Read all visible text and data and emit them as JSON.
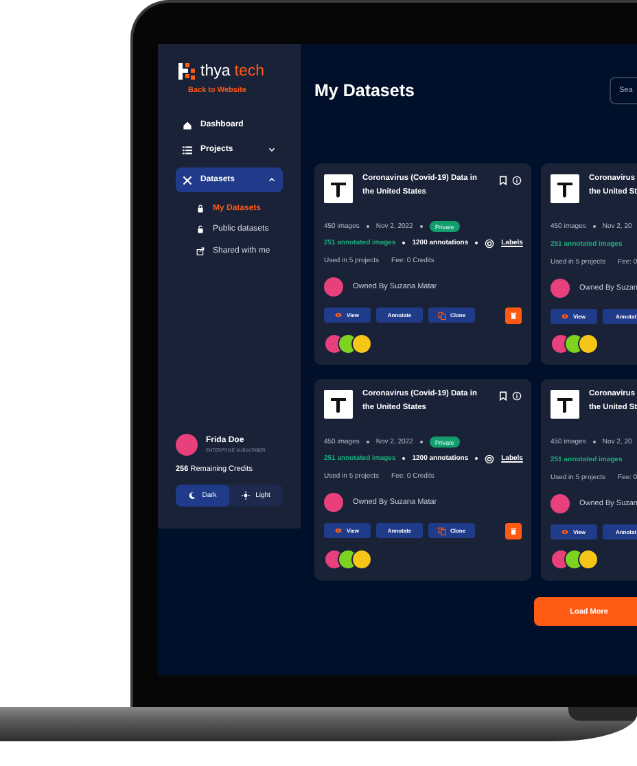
{
  "sidebar": {
    "logo": {
      "part_1": "thya",
      "part_2": "tech"
    },
    "back_link": "Back to Website",
    "nav": [
      {
        "kind": "link",
        "label": "Dashboard",
        "selected": false
      },
      {
        "kind": "group",
        "label": "Projects",
        "selected": false,
        "expanded": false
      },
      {
        "kind": "group",
        "label": "Datasets",
        "selected": true,
        "expanded": true,
        "children": [
          {
            "label": "My Datasets",
            "selected": true
          },
          {
            "label": "Public datasets",
            "selected": false
          },
          {
            "label": "Shared with me",
            "selected": false
          }
        ]
      }
    ],
    "user": {
      "name": "Frida Doe",
      "role": "ENTERPRISE SUBSCRIBER",
      "credits": "**256** Remaining Credits"
    },
    "theme": [
      {
        "label": "Dark",
        "selected": true
      },
      {
        "label": "Light",
        "selected": false
      }
    ]
  },
  "main": {
    "title": "My Datasets",
    "search": {
      "placeholder": "Sea"
    },
    "cards": [
      {
        "title_lines": [
          "Coronavirus (Covid-19) Data in",
          "the United States"
        ],
        "images": "450 images",
        "date": "Nov 2, 2022",
        "privacy": "Private",
        "annotated": "251 annotated images",
        "annotations": "1200 annotations",
        "labels": "Labels",
        "used": "Used in 5 projects",
        "fee": "Fee: 0 Credits",
        "owner": "Owned By Suzana Matar",
        "buttons": [
          {
            "kind": "view",
            "label": "View"
          },
          {
            "kind": "annotate",
            "label": "Annotate"
          },
          {
            "kind": "clone",
            "label": "Clone"
          },
          {
            "kind": "delete"
          }
        ]
      },
      {
        "title_lines": [
          "Coronavirus",
          "the United St"
        ],
        "images": "450 images",
        "date": "Nov 2, 20",
        "annotated": "251 annotated images",
        "used": "Used in 5 projects",
        "fee": "Fee: 0",
        "owner": "Owned By Suzan",
        "buttons": [
          {
            "kind": "view",
            "label": "View"
          },
          {
            "kind": "annotate",
            "label": "Annotat"
          }
        ]
      },
      {
        "title_lines": [
          "Coronavirus (Covid-19) Data in",
          "the United States"
        ],
        "images": "450 images",
        "date": "Nov 2, 2022",
        "privacy": "Private",
        "annotated": "251 annotated images",
        "annotations": "1200 annotations",
        "labels": "Labels",
        "used": "Used in 5 projects",
        "fee": "Fee: 0 Credits",
        "owner": "Owned By Suzana Matar",
        "buttons": [
          {
            "kind": "view",
            "label": "View"
          },
          {
            "kind": "annotate",
            "label": "Annotate"
          },
          {
            "kind": "clone",
            "label": "Clone"
          },
          {
            "kind": "delete"
          }
        ]
      },
      {
        "title_lines": [
          "Coronavirus",
          "the United St"
        ],
        "images": "450 images",
        "date": "Nov 2, 20",
        "annotated": "251 annotated images",
        "used": "Used in 5 projects",
        "fee": "Fee: 0",
        "owner": "Owned By Suzan",
        "buttons": [
          {
            "kind": "view",
            "label": "View"
          },
          {
            "kind": "annotate",
            "label": "Annotat"
          }
        ]
      }
    ],
    "load_more": "Load More"
  }
}
